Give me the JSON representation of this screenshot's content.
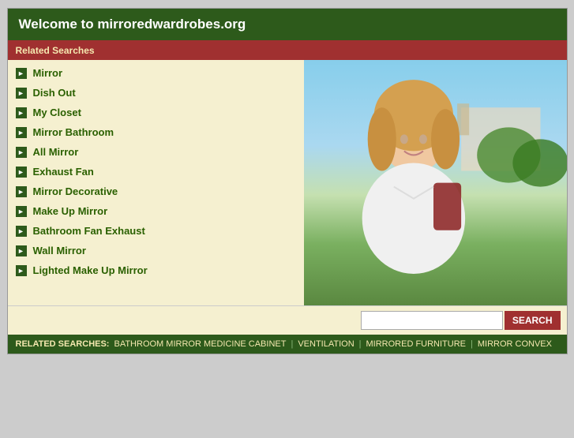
{
  "header": {
    "title": "Welcome to mirroredwardrobes.org"
  },
  "related_bar": {
    "label": "Related Searches"
  },
  "list_items": [
    {
      "label": "Mirror"
    },
    {
      "label": "Dish Out"
    },
    {
      "label": "My Closet"
    },
    {
      "label": "Mirror Bathroom"
    },
    {
      "label": "All Mirror"
    },
    {
      "label": "Exhaust Fan"
    },
    {
      "label": "Mirror Decorative"
    },
    {
      "label": "Make Up Mirror"
    },
    {
      "label": "Bathroom Fan Exhaust"
    },
    {
      "label": "Wall Mirror"
    },
    {
      "label": "Lighted Make Up Mirror"
    }
  ],
  "search": {
    "placeholder": "",
    "button_label": "SEARCH"
  },
  "footer": {
    "label": "RELATED SEARCHES:",
    "links": [
      "BATHROOM MIRROR MEDICINE CABINET",
      "VENTILATION",
      "MIRRORED FURNITURE",
      "MIRROR CONVEX"
    ]
  }
}
